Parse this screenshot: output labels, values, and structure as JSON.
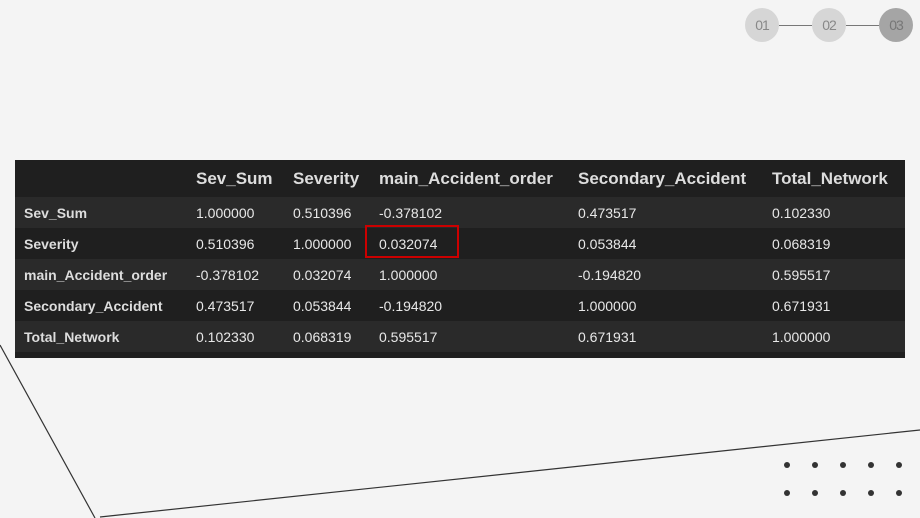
{
  "steps": [
    {
      "label": "01",
      "active": false
    },
    {
      "label": "02",
      "active": false
    },
    {
      "label": "03",
      "active": true
    }
  ],
  "table": {
    "columns": [
      "",
      "Sev_Sum",
      "Severity",
      "main_Accident_order",
      "Secondary_Accident",
      "Total_Network"
    ],
    "rows": [
      {
        "label": "Sev_Sum",
        "values": [
          "1.000000",
          "0.510396",
          "-0.378102",
          "0.473517",
          "0.102330"
        ]
      },
      {
        "label": "Severity",
        "values": [
          "0.510396",
          "1.000000",
          "0.032074",
          "0.053844",
          "0.068319"
        ]
      },
      {
        "label": "main_Accident_order",
        "values": [
          "-0.378102",
          "0.032074",
          "1.000000",
          "-0.194820",
          "0.595517"
        ]
      },
      {
        "label": "Secondary_Accident",
        "values": [
          "0.473517",
          "0.053844",
          "-0.194820",
          "1.000000",
          "0.671931"
        ]
      },
      {
        "label": "Total_Network",
        "values": [
          "0.102330",
          "0.068319",
          "0.595517",
          "0.671931",
          "1.000000"
        ]
      }
    ],
    "highlight": {
      "row": "Severity",
      "column": "main_Accident_order",
      "color": "#cc0000"
    }
  }
}
